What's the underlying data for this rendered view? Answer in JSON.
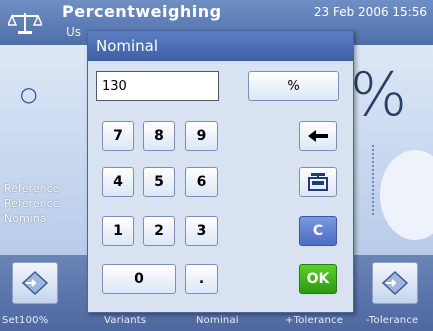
{
  "background": {
    "title": "Percentweighing",
    "user": "Us",
    "datetime": "23 Feb 2006 15:56",
    "unit_display": "%",
    "status_icon": "circle-indicator-icon",
    "info_labels": [
      "Reference",
      "Reference",
      "Nominal"
    ],
    "footer_buttons": [
      {
        "label": "Set100%",
        "icon": "set-reference-icon"
      },
      {
        "label": "Variants",
        "icon": "none"
      },
      {
        "label": "Nominal",
        "icon": "none"
      },
      {
        "label": "+Tolerance",
        "icon": "none"
      },
      {
        "label": "-Tolerance",
        "icon": "set-tolerance-icon"
      }
    ]
  },
  "dialog": {
    "title": "Nominal",
    "value": "130",
    "unit_button": "%",
    "keys": {
      "k7": "7",
      "k8": "8",
      "k9": "9",
      "k4": "4",
      "k5": "5",
      "k6": "6",
      "k1": "1",
      "k2": "2",
      "k3": "3",
      "k0": "0",
      "dot": ".",
      "clear": "C",
      "ok": "OK"
    },
    "icons": {
      "backspace": "backspace-arrow-icon",
      "scale": "weigh-in-icon"
    },
    "colors": {
      "ok": "#2c9a10",
      "clear": "#4c6dc2",
      "title_bar": "#3f60a8"
    }
  }
}
